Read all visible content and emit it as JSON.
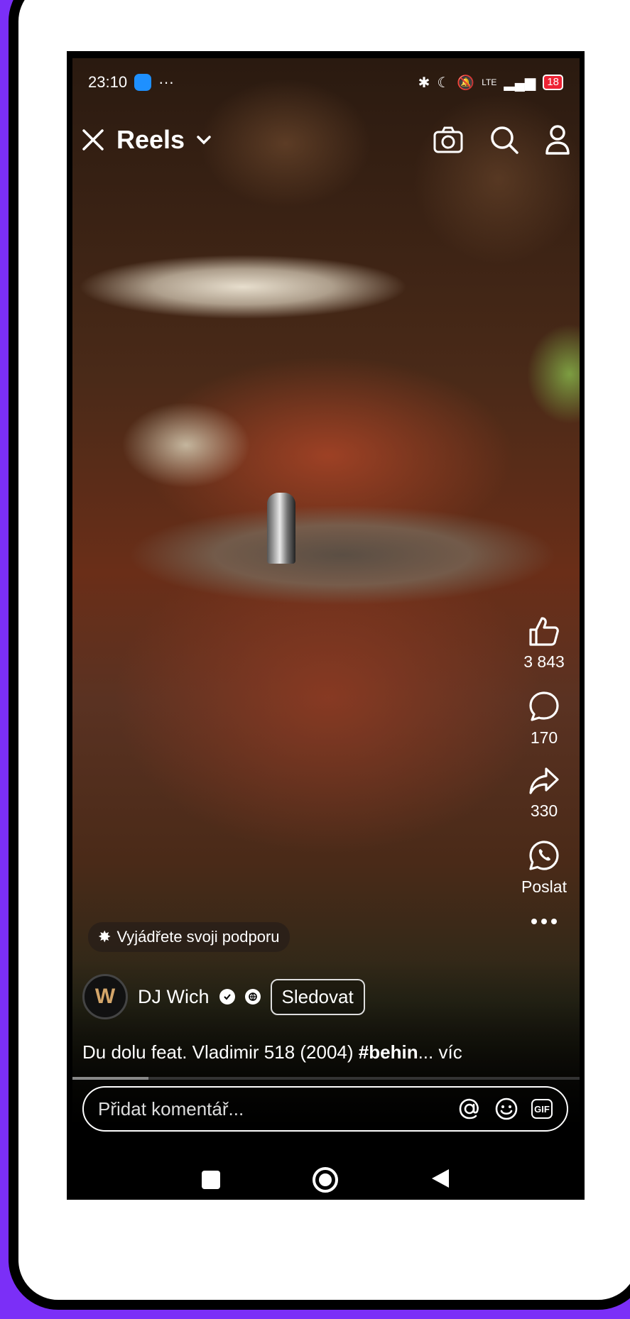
{
  "status_bar": {
    "time": "23:10",
    "dots": "···",
    "signal_label": "LTE",
    "battery": "18"
  },
  "header": {
    "title": "Reels",
    "icons": [
      "close-icon",
      "chevron-down-icon",
      "camera-icon",
      "search-icon",
      "profile-icon"
    ]
  },
  "actions": [
    {
      "name": "like",
      "icon": "thumbs-up-icon",
      "count": "3 843"
    },
    {
      "name": "comment",
      "icon": "comment-icon",
      "count": "170"
    },
    {
      "name": "share",
      "icon": "share-icon",
      "count": "330"
    },
    {
      "name": "whatsapp",
      "icon": "whatsapp-icon",
      "label": "Poslat"
    }
  ],
  "support": {
    "label": "Vyjádřete svoji podporu"
  },
  "user": {
    "avatar_letter": "W",
    "name": "DJ Wich",
    "follow_label": "Sledovat"
  },
  "caption": {
    "text": "Du dolu feat. Vladimir 518 (2004) ",
    "hashtag": "#behin",
    "more": "... víc"
  },
  "progress": {
    "fraction": 0.15
  },
  "comment_box": {
    "placeholder": "Přidat komentář...",
    "gif_label": "GIF"
  },
  "colors": {
    "frame": "#7b2ff7",
    "battery": "#ee2233"
  }
}
